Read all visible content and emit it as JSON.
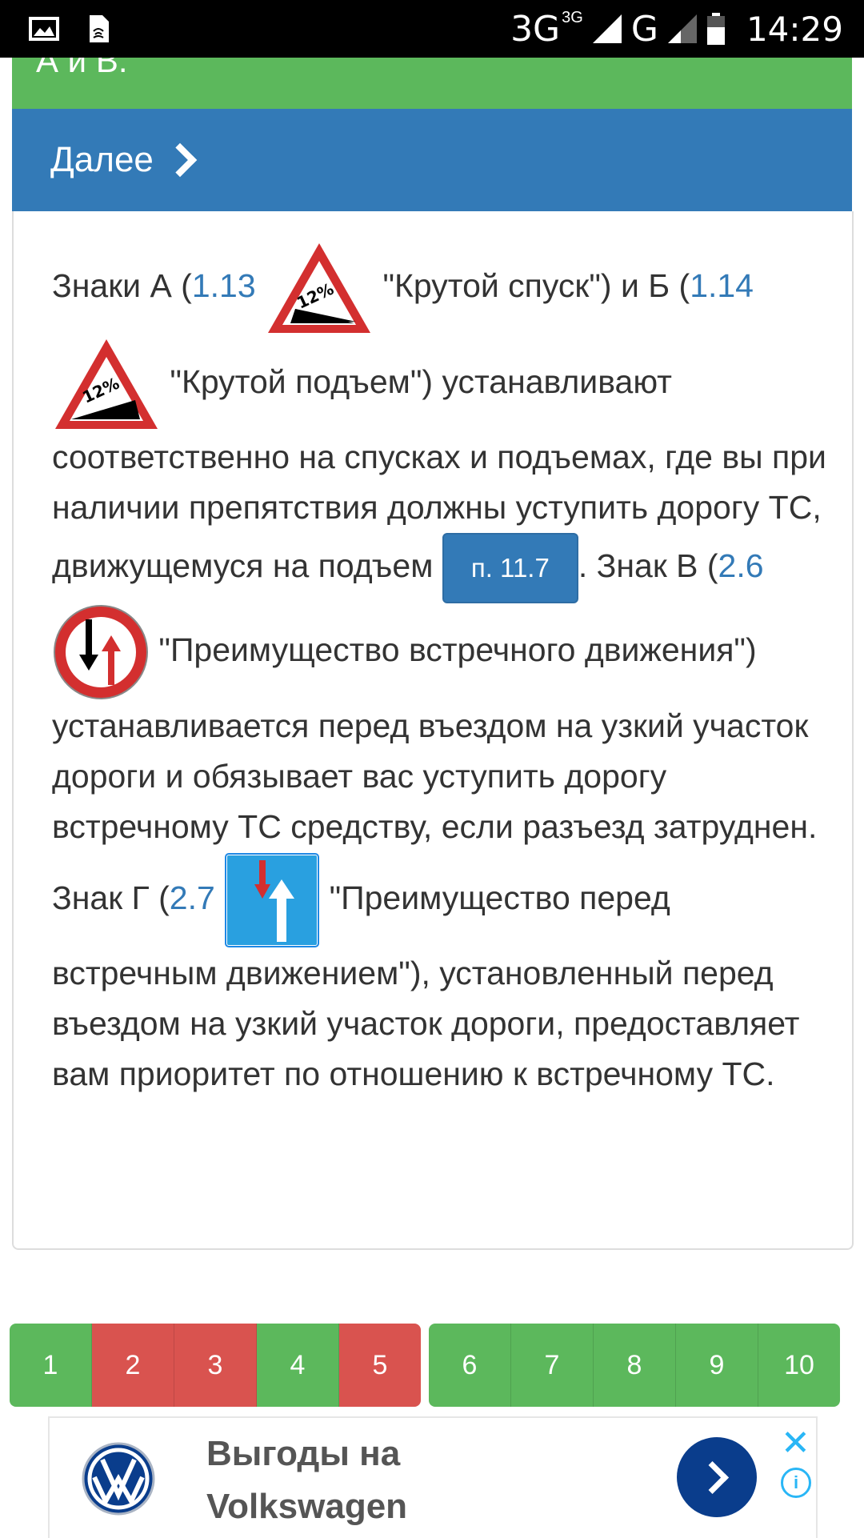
{
  "statusbar": {
    "network_3g": "3G",
    "network_3g_small": "3G",
    "network_g": "G",
    "time": "14:29"
  },
  "top_strip": {
    "partial_text": "А и В."
  },
  "nav": {
    "next_label": "Далее"
  },
  "article": {
    "t1": "Знаки А (",
    "link_1_13": "1.13",
    "t2": " \"Крутой спуск\") и Б (",
    "link_1_14": "1.14",
    "t3": " \"Крутой подъем\") устанавливают соответственно на спусках и подъемах, где вы при наличии препятствия должны уступить дорогу ТС, движущемуся на подъем ",
    "rule_button": "п. 11.7",
    "t4": ". Знак В (",
    "link_2_6": "2.6",
    "t5": " \"Преимущество встречного движения\") устанавливается перед въездом на узкий участок дороги и обязывает вас уступить дорогу встречному ТС средству, если разъезд затруднен. Знак Г (",
    "link_2_7": "2.7",
    "t6": " \"Преимущество перед встречным движением\"), установленный перед въездом на узкий участок дороги, предоставляет вам приоритет по отношению к встречному ТС.",
    "sign_percent": "12%"
  },
  "pagination": {
    "group1": [
      {
        "label": "1",
        "status": "correct"
      },
      {
        "label": "2",
        "status": "wrong"
      },
      {
        "label": "3",
        "status": "wrong"
      },
      {
        "label": "4",
        "status": "correct"
      },
      {
        "label": "5",
        "status": "wrong"
      }
    ],
    "group2": [
      {
        "label": "6",
        "status": "correct"
      },
      {
        "label": "7",
        "status": "correct"
      },
      {
        "label": "8",
        "status": "correct"
      },
      {
        "label": "9",
        "status": "correct"
      },
      {
        "label": "10",
        "status": "correct"
      }
    ]
  },
  "ad": {
    "title": "Выгоды на Volkswagen",
    "close": "✕",
    "info": "i"
  },
  "colors": {
    "correct": "#5cb85c",
    "wrong": "#d9534f",
    "primary": "#337ab7"
  }
}
